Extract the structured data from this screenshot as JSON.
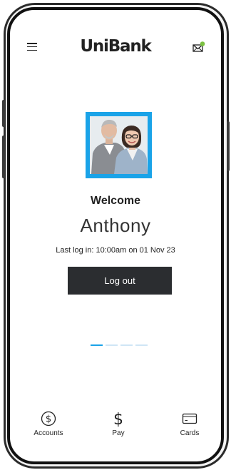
{
  "header": {
    "logo_text": "UniBank",
    "menu_icon": "hamburger-menu-icon",
    "mail_icon": "mail-icon",
    "notification_color": "#7cc142"
  },
  "profile": {
    "welcome": "Welcome",
    "name": "Anthony",
    "last_login": "Last log in: 10:00am on 01 Nov 23",
    "frame_color": "#1aa3e8"
  },
  "actions": {
    "logout_label": "Log out"
  },
  "pager": {
    "pages": 4,
    "active_index": 0
  },
  "tabbar": {
    "items": [
      {
        "label": "Accounts",
        "icon": "dollar-circle-icon"
      },
      {
        "label": "Pay",
        "icon": "dollar-icon"
      },
      {
        "label": "Cards",
        "icon": "card-icon"
      }
    ]
  },
  "colors": {
    "accent": "#1aa3e8",
    "button": "#2b2d30"
  }
}
